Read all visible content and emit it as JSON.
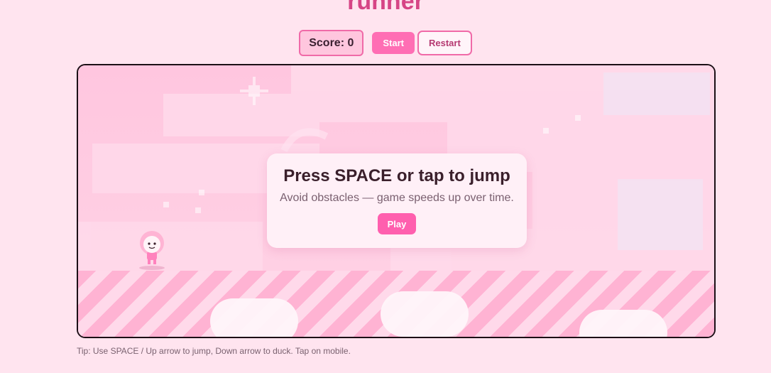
{
  "header": {
    "title": "runner"
  },
  "hud": {
    "score_label": "Score: 0",
    "start_label": "Start",
    "restart_label": "Restart"
  },
  "overlay": {
    "title": "Press SPACE or tap to jump",
    "subtitle": "Avoid obstacles — game speeds up over time.",
    "play_label": "Play"
  },
  "tip": "Tip: Use SPACE / Up arrow to jump, Down arrow to duck. Tap on mobile.",
  "colors": {
    "accent": "#ff6eb4",
    "background": "#ffe4ef",
    "ground_stripe": "#ffb3d3"
  }
}
